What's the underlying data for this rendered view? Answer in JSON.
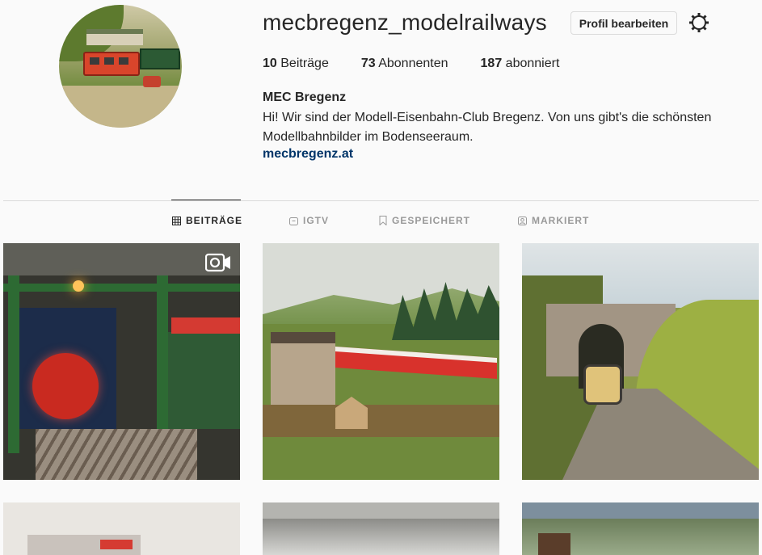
{
  "profile": {
    "username": "mecbregenz_modelrailways",
    "edit_label": "Profil bearbeiten",
    "posts_count": "10",
    "posts_label": "Beiträge",
    "followers_count": "73",
    "followers_label": "Abonnenten",
    "following_count": "187",
    "following_label": "abonniert",
    "full_name": "MEC Bregenz",
    "bio": "Hi! Wir sind der Modell-Eisenbahn-Club Bregenz. Von uns gibt's die schönsten Modellbahnbilder im Bodenseeraum.",
    "website": "mecbregenz.at"
  },
  "tabs": [
    {
      "label": "BEITRÄGE",
      "icon": "grid-icon",
      "active": true
    },
    {
      "label": "IGTV",
      "icon": "igtv-icon",
      "active": false
    },
    {
      "label": "GESPEICHERT",
      "icon": "bookmark-icon",
      "active": false
    },
    {
      "label": "MARKIERT",
      "icon": "tagged-icon",
      "active": false
    }
  ],
  "posts": [
    {
      "type": "video",
      "icon": "video-icon"
    },
    {
      "type": "photo"
    },
    {
      "type": "photo"
    },
    {
      "type": "photo"
    },
    {
      "type": "photo"
    },
    {
      "type": "photo"
    }
  ],
  "colors": {
    "background": "#fafafa",
    "text": "#262626",
    "muted": "#999999",
    "link": "#003569",
    "border": "#dbdbdb"
  }
}
